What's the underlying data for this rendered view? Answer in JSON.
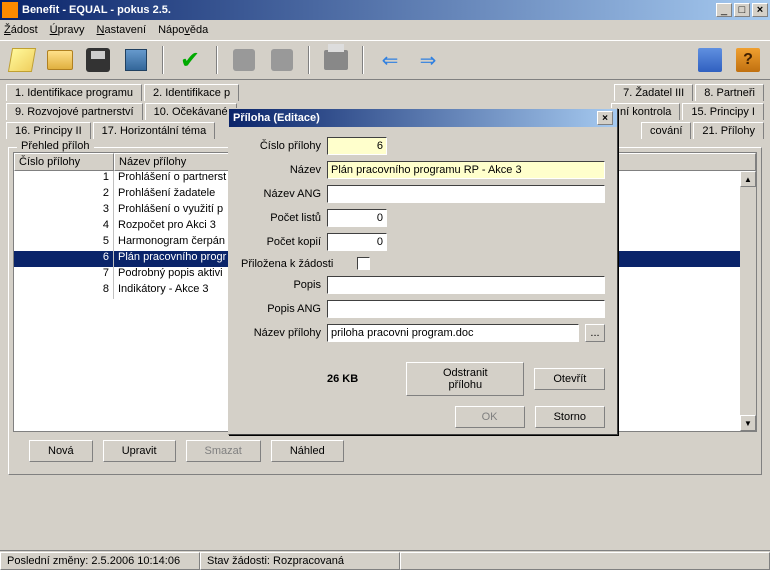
{
  "window": {
    "title": "Benefit - EQUAL - pokus 2.5.",
    "min": "_",
    "max": "□",
    "close": "×"
  },
  "menu": {
    "zadost": "Žádost",
    "upravy": "Úpravy",
    "nastaveni": "Nastavení",
    "napoveda": "Nápověda"
  },
  "tabs": {
    "r1": [
      "1. Identifikace programu",
      "2. Identifikace p",
      "7. Žadatel III",
      "8. Partneři"
    ],
    "r2": [
      "9. Rozvojové partnerství",
      "10. Očekávané",
      "ní kontrola",
      "15. Principy I"
    ],
    "r3": [
      "16. Principy II",
      "17. Horizontální téma",
      "cování",
      "21. Přílohy"
    ]
  },
  "group_title": "Přehled příloh",
  "grid": {
    "h1": "Číslo přílohy",
    "h2": "Název přílohy",
    "rows": [
      {
        "n": "1",
        "t": "Prohlášení o partnerst"
      },
      {
        "n": "2",
        "t": "Prohlášení žadatele"
      },
      {
        "n": "3",
        "t": "Prohlášení o využití p"
      },
      {
        "n": "4",
        "t": "Rozpočet pro Akci 3"
      },
      {
        "n": "5",
        "t": "Harmonogram čerpán"
      },
      {
        "n": "6",
        "t": "Plán pracovního progr"
      },
      {
        "n": "7",
        "t": "Podrobný popis aktivi"
      },
      {
        "n": "8",
        "t": "Indikátory - Akce 3"
      }
    ]
  },
  "buttons": {
    "nova": "Nová",
    "upravit": "Upravit",
    "smazat": "Smazat",
    "nahled": "Náhled"
  },
  "status": {
    "s1": "Poslední změny: 2.5.2006 10:14:06",
    "s2": "Stav žádosti: Rozpracovaná"
  },
  "dialog": {
    "title": "Příloha (Editace)",
    "labels": {
      "cislo": "Číslo přílohy",
      "nazev": "Název",
      "nazev_ang": "Název ANG",
      "pocet_listu": "Počet listů",
      "pocet_kopii": "Počet kopií",
      "prilozena": "Přiložena k žádosti",
      "popis": "Popis",
      "popis_ang": "Popis ANG",
      "nazev_prilohy": "Název přílohy"
    },
    "values": {
      "cislo": "6",
      "nazev": "Plán pracovního programu RP - Akce 3",
      "nazev_ang": "",
      "pocet_listu": "0",
      "pocet_kopii": "0",
      "popis": "",
      "popis_ang": "",
      "nazev_prilohy": "priloha pracovni program.doc"
    },
    "filesize": "26 KB",
    "btn_odstranit": "Odstranit přílohu",
    "btn_otevrit": "Otevřít",
    "btn_ok": "OK",
    "btn_storno": "Storno",
    "browse": "..."
  }
}
